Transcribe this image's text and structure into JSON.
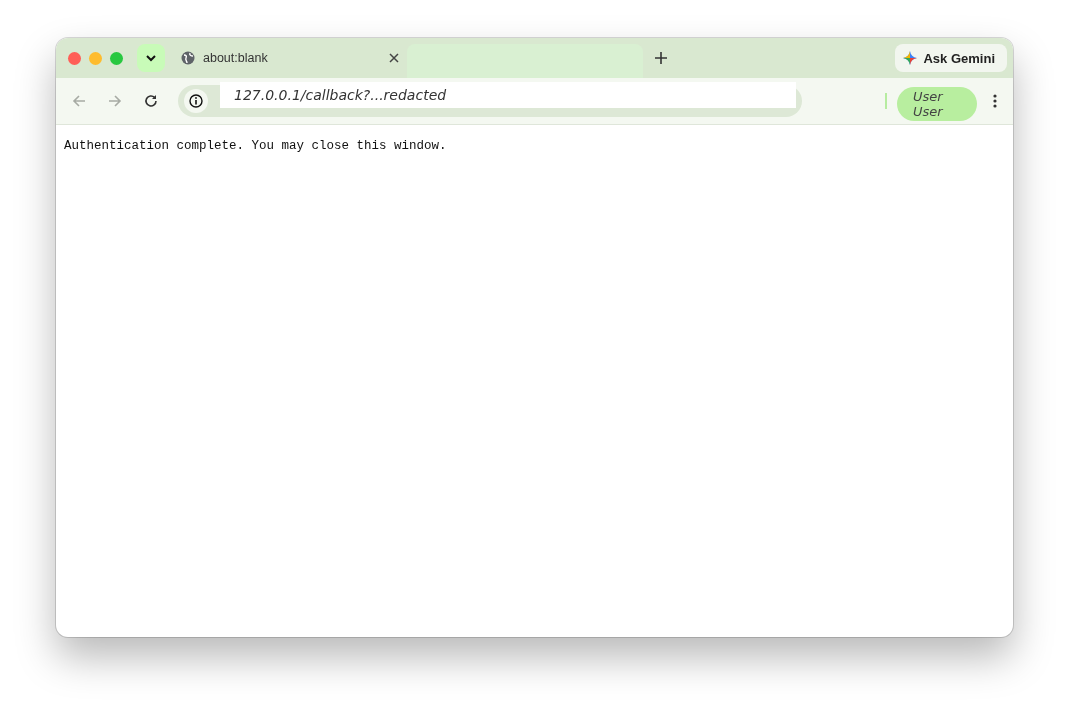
{
  "tabs": [
    {
      "title": "about:blank",
      "selected": false
    },
    {
      "selected": true
    }
  ],
  "gemini_button": {
    "label": "Ask Gemini"
  },
  "toolbar": {
    "back": {
      "disabled": true
    },
    "forward": {
      "disabled": true
    },
    "url": "127.0.0.1/callback?...redacted",
    "profile": "User User"
  },
  "page": {
    "text": "Authentication complete. You may close this window."
  }
}
